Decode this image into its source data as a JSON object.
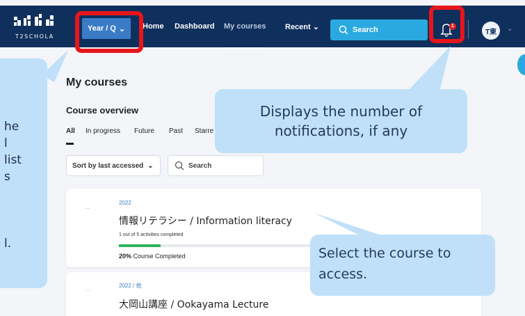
{
  "brand": {
    "logo_text": "T2SCHOLA"
  },
  "nav": {
    "year_q_label": "Year / Q",
    "items": [
      {
        "label": "Home",
        "active": false
      },
      {
        "label": "Dashboard",
        "active": false
      },
      {
        "label": "My courses",
        "active": true
      },
      {
        "label": "Recent",
        "active": false
      }
    ],
    "search_label": "Search",
    "notification_count": "1",
    "avatar_text": "T東"
  },
  "page": {
    "title": "My courses",
    "section_title": "Course overview",
    "tabs": [
      "All",
      "In progress",
      "Future",
      "Past",
      "Starre"
    ],
    "sort_label": "Sort by last accessed",
    "search_placeholder": "Search"
  },
  "courses": [
    {
      "year": "2022",
      "title": "情報リテラシー / Information literacy",
      "activities": "1 out of 5 activities completed",
      "progress": 0.2,
      "progress_pct": "20%",
      "completed_label": "Course Completed"
    },
    {
      "year": "2022 / 他",
      "title": "大岡山講座 / Ookayama Lecture"
    }
  ],
  "callouts": {
    "left_lines": [
      "he",
      "l",
      "list",
      "s",
      "",
      "l."
    ],
    "notifications": [
      "Displays the number of",
      "notifications, if any"
    ],
    "course": [
      "Select the course to",
      "access."
    ]
  },
  "colors": {
    "topbar": "#0f2f5c",
    "accent": "#3a7bc6",
    "search": "#2aa9e0",
    "highlight": "#e8151b",
    "callout": "#bfe0f8",
    "progress": "#2cb35c"
  }
}
